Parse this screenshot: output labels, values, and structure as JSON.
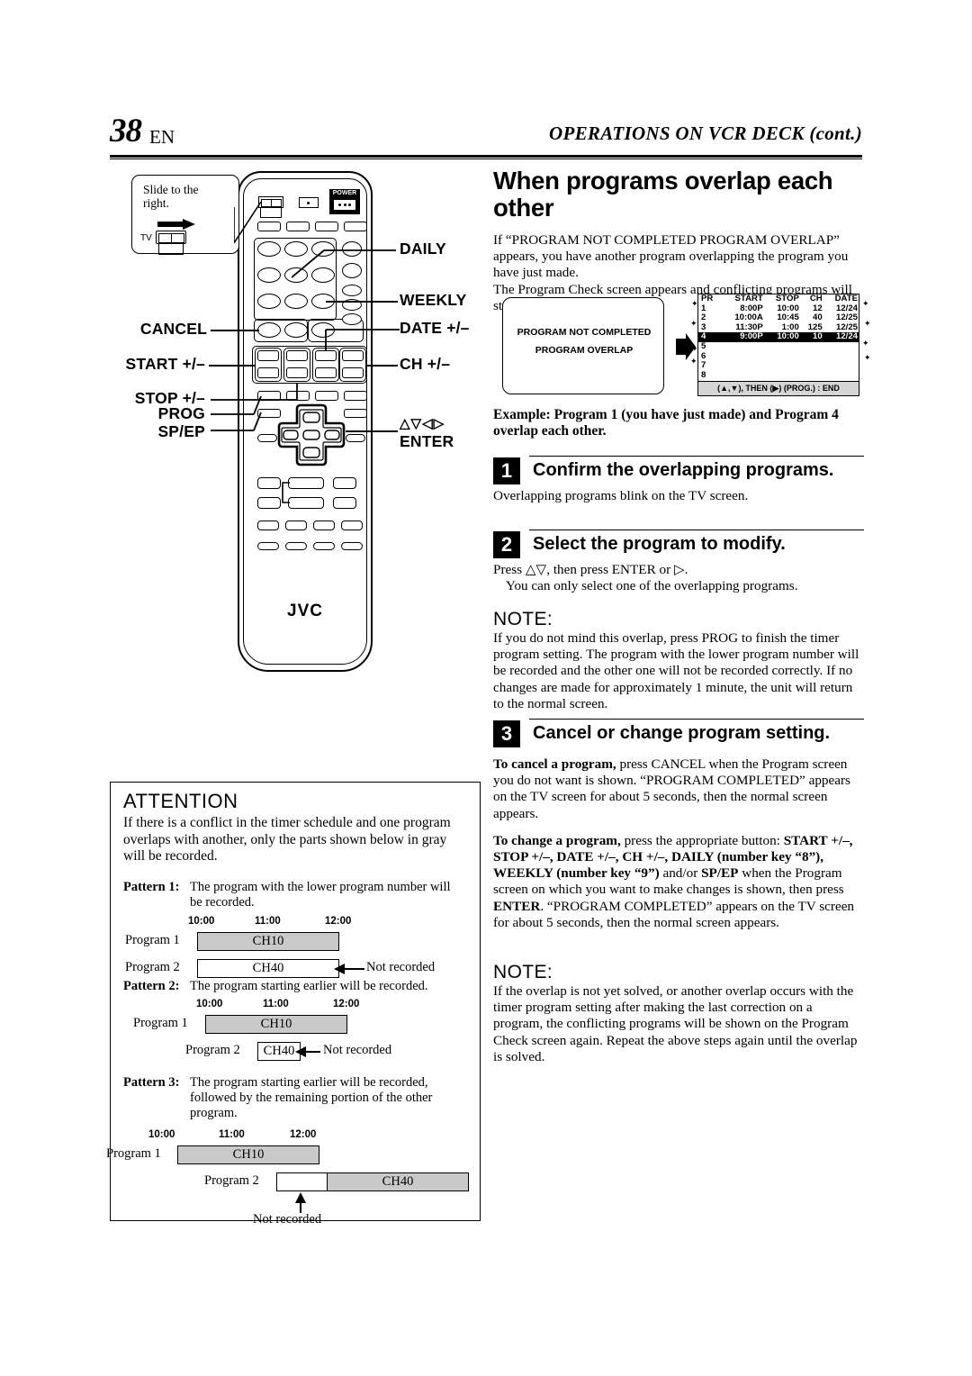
{
  "header": {
    "page_number": "38",
    "page_lang": "EN",
    "title": "OPERATIONS ON VCR DECK (cont.)"
  },
  "remote_figure": {
    "callout": {
      "line1": "Slide to the",
      "line2": "right.",
      "tv_label": "TV"
    },
    "power_label": "POWER",
    "brand": "JVC",
    "labels_left": [
      {
        "name": "cancel",
        "text": "CANCEL"
      },
      {
        "name": "start",
        "text": "START +/–"
      },
      {
        "name": "stop",
        "text": "STOP +/–"
      },
      {
        "name": "prog",
        "text": "PROG"
      },
      {
        "name": "spep",
        "text": "SP/EP"
      }
    ],
    "labels_right": [
      {
        "name": "daily",
        "text": "DAILY"
      },
      {
        "name": "weekly",
        "text": "WEEKLY"
      },
      {
        "name": "date",
        "text": "DATE +/–"
      },
      {
        "name": "ch",
        "text": "CH +/–"
      },
      {
        "name": "arrows",
        "text": "△▽◁▷"
      },
      {
        "name": "enter",
        "text": "ENTER"
      }
    ]
  },
  "main": {
    "section_title": "When programs overlap each other",
    "intro_p1": "If “PROGRAM NOT COMPLETED PROGRAM OVERLAP” appears, you have another program overlapping the program you have just made.",
    "intro_p2": "The Program Check screen appears and conflicting programs will start blinking.",
    "example": "Example: Program 1 (you have just made) and Program 4 overlap each other."
  },
  "message_screen": {
    "line1": "PROGRAM NOT COMPLETED",
    "line2": "PROGRAM OVERLAP"
  },
  "program_check_screen": {
    "columns": [
      "PR",
      "START",
      "STOP",
      "CH",
      "DATE"
    ],
    "rows": [
      {
        "pr": "1",
        "start": "8:00P",
        "stop": "10:00",
        "ch": "12",
        "date": "12/24",
        "highlight": false
      },
      {
        "pr": "2",
        "start": "10:00A",
        "stop": "10:45",
        "ch": "40",
        "date": "12/25",
        "highlight": false
      },
      {
        "pr": "3",
        "start": "11:30P",
        "stop": "1:00",
        "ch": "125",
        "date": "12/25",
        "highlight": false
      },
      {
        "pr": "4",
        "start": "9:00P",
        "stop": "10:00",
        "ch": "10",
        "date": "12/24",
        "highlight": true
      },
      {
        "pr": "5",
        "start": "",
        "stop": "",
        "ch": "",
        "date": "",
        "highlight": false
      },
      {
        "pr": "6",
        "start": "",
        "stop": "",
        "ch": "",
        "date": "",
        "highlight": false
      },
      {
        "pr": "7",
        "start": "",
        "stop": "",
        "ch": "",
        "date": "",
        "highlight": false
      },
      {
        "pr": "8",
        "start": "",
        "stop": "",
        "ch": "",
        "date": "",
        "highlight": false
      }
    ],
    "footer": "(▲,▼), THEN (▶)  (PROG.) : END"
  },
  "steps": [
    {
      "number": "1",
      "title": "Confirm the overlapping programs.",
      "body_line1": "Overlapping programs blink on the TV screen.",
      "body_line2": ""
    },
    {
      "number": "2",
      "title": "Select the program to modify.",
      "body_line1": "Press △▽, then press ENTER or ▷.",
      "body_line2": "You can only select one of the overlapping programs."
    },
    {
      "number": "3",
      "title": "Cancel or change program setting.",
      "body_line1": "",
      "body_line2": ""
    }
  ],
  "note1": {
    "head": "NOTE:",
    "text": "If you do not mind this overlap, press PROG to finish the timer program setting. The program with the lower program number will be recorded and the other one will not be recorded correctly. If no changes are made for approximately 1 minute, the unit will return to the normal screen."
  },
  "step3_body": {
    "para1_lead": "To cancel a program,",
    "para1": " press CANCEL when the Program screen you do not want is shown. “PROGRAM COMPLETED” appears on the TV screen for about 5 seconds, then the normal screen appears.",
    "para2_lead": "To change a program,",
    "para2_a": " press the appropriate button:",
    "para2_b": "START +/–, STOP +/–, DATE +/–, CH +/–, DAILY (number key “8”), WEEKLY (number key “9”)",
    "para2_c": " and/or ",
    "para2_d": "SP/EP",
    "para2_e": " when the Program screen on which you want to make changes is shown, then press ",
    "para2_f": "ENTER",
    "para2_g": ". “PROGRAM COMPLETED” appears on the TV screen for about 5 seconds, then the normal screen appears."
  },
  "note2": {
    "head": "NOTE:",
    "text": "If the overlap is not yet solved, or another overlap occurs with the timer program setting after making the last correction on a program, the conflicting programs will be shown on the Program Check screen again. Repeat the above steps again until the overlap is solved."
  },
  "attention": {
    "title": "ATTENTION",
    "body": "If there is a conflict in the timer schedule and one program overlaps with another, only the parts shown below in gray will be recorded.",
    "patterns": [
      {
        "label": "Pattern 1:",
        "desc": "The program with the lower program number will be recorded.",
        "ticks": [
          "10:00",
          "11:00",
          "12:00"
        ],
        "rows": [
          {
            "name": "Program 1",
            "channel": "CH10",
            "fill": "gray",
            "note": ""
          },
          {
            "name": "Program 2",
            "channel": "CH40",
            "fill": "white",
            "note": "Not recorded"
          }
        ]
      },
      {
        "label": "Pattern 2:",
        "desc": "The program starting earlier will be recorded.",
        "ticks": [
          "10:00",
          "11:00",
          "12:00"
        ],
        "rows": [
          {
            "name": "Program 1",
            "channel": "CH10",
            "fill": "gray",
            "note": ""
          },
          {
            "name": "Program 2",
            "channel": "CH40",
            "fill": "white",
            "note": "Not recorded"
          }
        ]
      },
      {
        "label": "Pattern 3:",
        "desc": "The program starting earlier will be recorded, followed by the remaining portion of the other program.",
        "ticks": [
          "10:00",
          "11:00",
          "12:00"
        ],
        "rows": [
          {
            "name": "Program 1",
            "channel": "CH10",
            "fill": "gray",
            "note": ""
          },
          {
            "name": "Program 2",
            "channel": "CH40",
            "fill": "split",
            "note": "Not recorded"
          }
        ]
      }
    ]
  },
  "colors": {
    "gray_fill": "#c9c9c9",
    "screen_footer": "#d5d5d5",
    "ink": "#000000"
  }
}
